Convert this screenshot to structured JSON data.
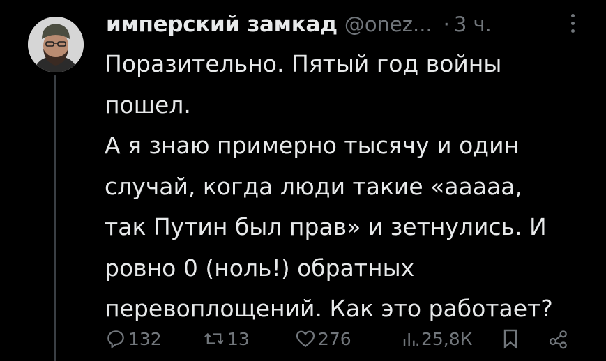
{
  "post": {
    "author_name": "имперский замкад",
    "author_handle": "@onez...",
    "separator": "·",
    "time": "3 ч.",
    "text_lines": [
      "Поразительно. Пятый год войны",
      "пошел.",
      "А я знаю примерно тысячу и один",
      "случай, когда люди такие «ааааа,",
      "так Путин был прав» и зетнулись. И",
      "ровно 0 (ноль!) обратных",
      "перевоплощений. Как это работает?"
    ]
  },
  "actions": {
    "replies": "132",
    "reposts": "13",
    "likes": "276",
    "views": "25,8К"
  },
  "colors": {
    "background": "#000000",
    "text": "#e7e9ea",
    "muted": "#71767b",
    "thread_line": "#3a3f44"
  },
  "icons": [
    "reply-icon",
    "repost-icon",
    "like-icon",
    "views-icon",
    "bookmark-icon",
    "share-icon",
    "more-icon"
  ]
}
